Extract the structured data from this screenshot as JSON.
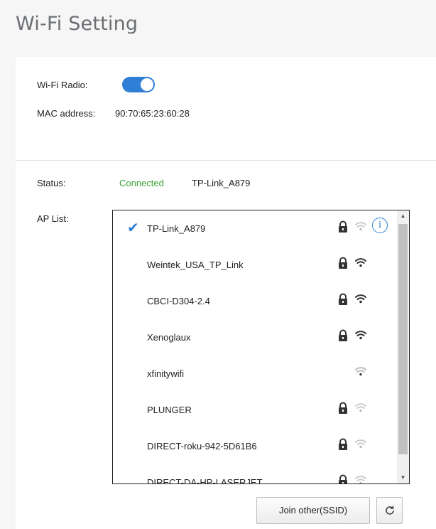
{
  "page": {
    "title": "Wi-Fi Setting"
  },
  "wifi_radio": {
    "label": "Wi-Fi Radio:",
    "enabled": true,
    "accent_color": "#2f7fd6"
  },
  "mac": {
    "label": "MAC address:",
    "value": "90:70:65:23:60:28"
  },
  "status": {
    "label": "Status:",
    "state": "Connected",
    "state_color": "#3aa335",
    "network": "TP-Link_A879"
  },
  "ap_list": {
    "label": "AP List:",
    "items": [
      {
        "name": "TP-Link_A879",
        "connected": true,
        "locked": true,
        "signal": "weak",
        "info": "i"
      },
      {
        "name": "Weintek_USA_TP_Link",
        "connected": false,
        "locked": true,
        "signal": "strong"
      },
      {
        "name": "CBCI-D304-2.4",
        "connected": false,
        "locked": true,
        "signal": "strong"
      },
      {
        "name": "Xenoglaux",
        "connected": false,
        "locked": true,
        "signal": "strong"
      },
      {
        "name": "xfinitywifi",
        "connected": false,
        "locked": false,
        "signal": "medium"
      },
      {
        "name": "PLUNGER",
        "connected": false,
        "locked": true,
        "signal": "weak"
      },
      {
        "name": "DIRECT-roku-942-5D61B6",
        "connected": false,
        "locked": true,
        "signal": "weak"
      },
      {
        "name": "DIRECT-DA-HP-LASERJET",
        "connected": false,
        "locked": true,
        "signal": "weak"
      }
    ],
    "check_icon": "checkmark-icon",
    "lock_icon": "lock-icon",
    "wifi_icon": "wifi-signal-icon"
  },
  "buttons": {
    "join_other": "Join other(SSID)",
    "refresh_icon": "refresh-icon"
  }
}
